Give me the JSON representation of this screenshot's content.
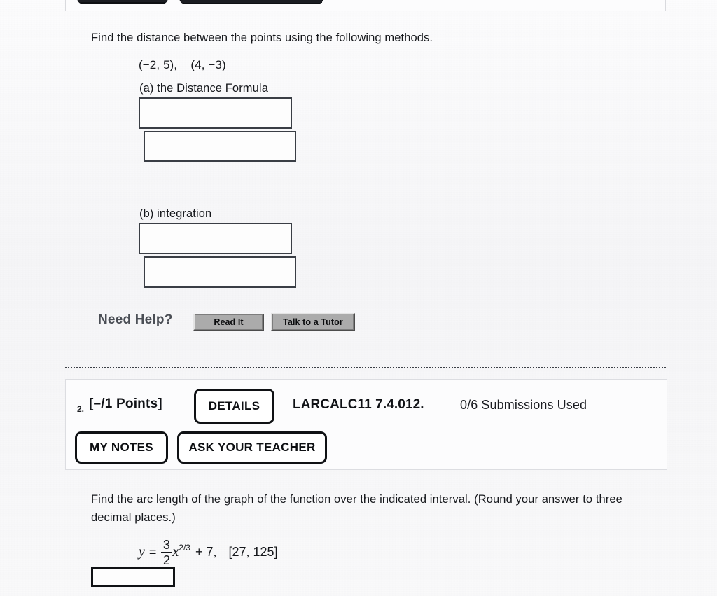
{
  "document": {
    "page_background": "#fbfbfc",
    "ink_color": "#15171b"
  },
  "question1": {
    "prompt": "Find the distance between the points using the following methods.",
    "points_expression": "(−2, 5),    (4, −3)",
    "part_a": {
      "label": "(a) the Distance Formula",
      "answer_boxes": [
        {
          "value": "",
          "placeholder": ""
        },
        {
          "value": "",
          "placeholder": ""
        }
      ]
    },
    "part_b": {
      "label": "(b) integration",
      "answer_boxes": [
        {
          "value": "",
          "placeholder": ""
        },
        {
          "value": "",
          "placeholder": ""
        }
      ]
    },
    "need_help": {
      "label": "Need Help?",
      "buttons": [
        {
          "label": "Read It",
          "name": "read-it-button"
        },
        {
          "label": "Talk to a Tutor",
          "name": "talk-to-a-tutor-button"
        }
      ]
    }
  },
  "question2": {
    "number": "2.",
    "points": "[–/1 Points]",
    "details_button": "DETAILS",
    "textbook_code": "LARCALC11 7.4.012.",
    "submissions": "0/6 Submissions Used",
    "my_notes_button": "MY NOTES",
    "ask_your_teacher_button": "ASK YOUR TEACHER",
    "prompt": "Find the arc length of the graph of the function over the indicated interval. (Round your answer to three decimal places.)",
    "formula": {
      "lhs": "y",
      "equals": "=",
      "fraction_numerator": "3",
      "fraction_denominator": "2",
      "variable": "x",
      "exponent": "2/3",
      "plus_term": "+ 7,",
      "interval": "[27, 125]"
    },
    "answer_box": {
      "value": "",
      "placeholder": ""
    }
  }
}
